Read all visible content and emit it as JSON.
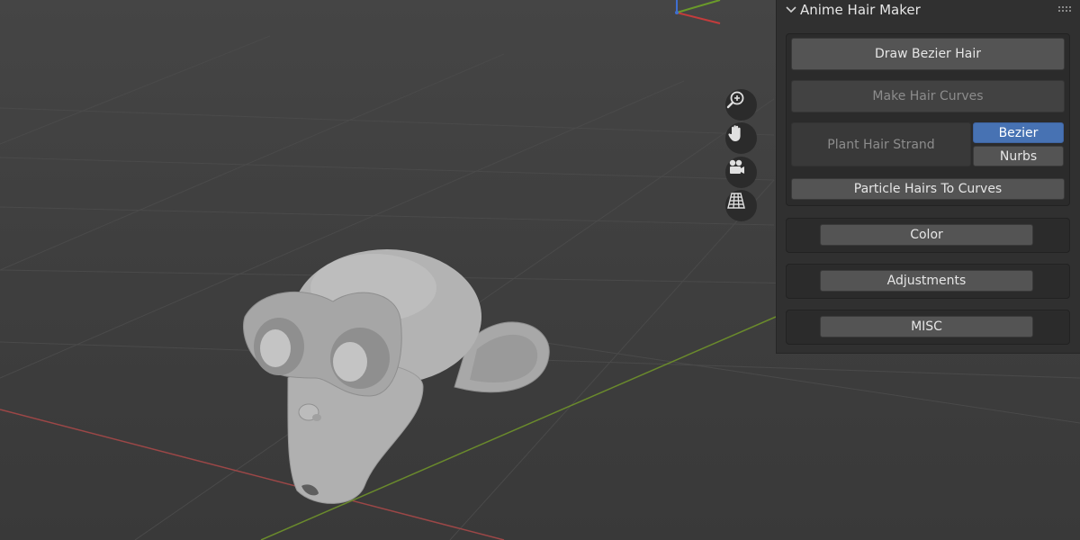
{
  "panel": {
    "title": "Anime Hair Maker",
    "buttons": {
      "draw_bezier_hair": "Draw Bezier Hair",
      "make_hair_curves": "Make Hair Curves",
      "plant_hair_strand": "Plant Hair Strand",
      "particle_hairs_to_curves": "Particle Hairs To Curves"
    },
    "curve_type": {
      "options": [
        "Bezier",
        "Nurbs"
      ],
      "selected": "Bezier"
    },
    "sections": {
      "color": "Color",
      "adjustments": "Adjustments",
      "misc": "MISC"
    }
  },
  "viewport_nav": [
    "zoom-icon",
    "hand-pan-icon",
    "camera-icon",
    "orthographic-grid-icon"
  ],
  "colors": {
    "accent": "#4772b3",
    "x_axis": "#b34a4a",
    "y_axis": "#6f8a2e"
  }
}
